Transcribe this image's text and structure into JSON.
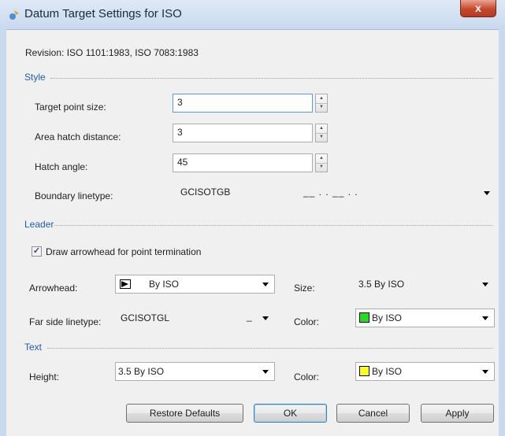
{
  "window": {
    "title": "Datum Target Settings for ISO",
    "close_glyph": "x"
  },
  "revision": "Revision: ISO 1101:1983, ISO 7083:1983",
  "style": {
    "heading": "Style",
    "target_point_size": {
      "label": "Target point size:",
      "value": "3"
    },
    "area_hatch_distance": {
      "label": "Area hatch distance:",
      "value": "3"
    },
    "hatch_angle": {
      "label": "Hatch angle:",
      "value": "45"
    },
    "boundary_linetype": {
      "label": "Boundary linetype:",
      "value": "GCISOTGB",
      "preview": "__ . . __ . ."
    }
  },
  "leader": {
    "heading": "Leader",
    "draw_arrowhead": {
      "label": "Draw arrowhead for point termination",
      "checked": true
    },
    "arrowhead": {
      "label": "Arrowhead:",
      "value": "By ISO"
    },
    "size": {
      "label": "Size:",
      "value": "3.5 By ISO"
    },
    "far_side_linetype": {
      "label": "Far side linetype:",
      "value": "GCISOTGL",
      "preview": "_"
    },
    "color": {
      "label": "Color:",
      "value": "By ISO",
      "swatch": "#22dd22"
    }
  },
  "text": {
    "heading": "Text",
    "height": {
      "label": "Height:",
      "value": "3.5 By ISO"
    },
    "color": {
      "label": "Color:",
      "value": "By ISO",
      "swatch": "#ffff22"
    }
  },
  "buttons": {
    "restore": "Restore Defaults",
    "ok": "OK",
    "cancel": "Cancel",
    "apply": "Apply"
  },
  "icons": {
    "app": "datum-target-icon",
    "close": "close-icon",
    "dropdown": "chevron-down-icon",
    "arrowhead": "filled-arrowhead-icon"
  }
}
